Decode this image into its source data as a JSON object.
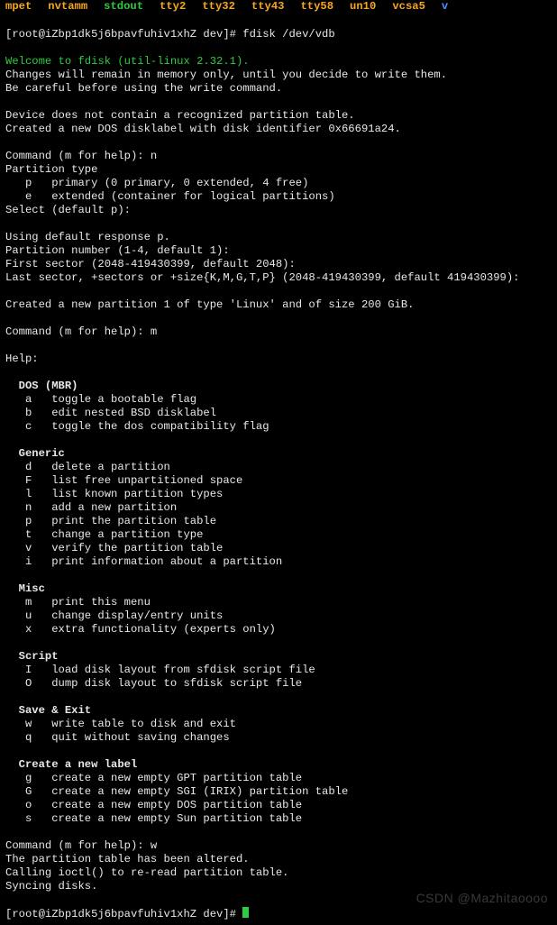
{
  "tabs": {
    "t0": "mpet",
    "t1": "nvtamm",
    "t2": "stdout",
    "t3": "tty2",
    "t4": "tty32",
    "t5": "tty43",
    "t6": "tty58",
    "t7": "un10",
    "t8": "vcsa5",
    "t9": "v"
  },
  "prompt": {
    "line": "[root@iZbp1dk5j6bpavfuhiv1xhZ dev]# fdisk /dev/vdb"
  },
  "welcome": "Welcome to fdisk (util-linux 2.32.1).",
  "intro": {
    "l1": "Changes will remain in memory only, until you decide to write them.",
    "l2": "Be careful before using the write command."
  },
  "device": {
    "l1": "Device does not contain a recognized partition table.",
    "l2": "Created a new DOS disklabel with disk identifier 0x66691a24."
  },
  "cmd_n": "Command (m for help): n",
  "ptype": {
    "hdr": "Partition type",
    "p": "   p   primary (0 primary, 0 extended, 4 free)",
    "e": "   e   extended (container for logical partitions)",
    "sel": "Select (default p):"
  },
  "defaults": {
    "l1": "Using default response p.",
    "l2": "Partition number (1-4, default 1):",
    "l3": "First sector (2048-419430399, default 2048):",
    "l4": "Last sector, +sectors or +size{K,M,G,T,P} (2048-419430399, default 419430399):"
  },
  "created": "Created a new partition 1 of type 'Linux' and of size 200 GiB.",
  "cmd_m": "Command (m for help): m",
  "help_hdr": "Help:",
  "sections": {
    "dos": {
      "title": "  DOS (MBR)",
      "a": "   a   toggle a bootable flag",
      "b": "   b   edit nested BSD disklabel",
      "c": "   c   toggle the dos compatibility flag"
    },
    "generic": {
      "title": "  Generic",
      "d": "   d   delete a partition",
      "F": "   F   list free unpartitioned space",
      "l": "   l   list known partition types",
      "n": "   n   add a new partition",
      "p": "   p   print the partition table",
      "t": "   t   change a partition type",
      "v": "   v   verify the partition table",
      "i": "   i   print information about a partition"
    },
    "misc": {
      "title": "  Misc",
      "m": "   m   print this menu",
      "u": "   u   change display/entry units",
      "x": "   x   extra functionality (experts only)"
    },
    "script": {
      "title": "  Script",
      "I": "   I   load disk layout from sfdisk script file",
      "O": "   O   dump disk layout to sfdisk script file"
    },
    "save": {
      "title": "  Save & Exit",
      "w": "   w   write table to disk and exit",
      "q": "   q   quit without saving changes"
    },
    "label": {
      "title": "  Create a new label",
      "g": "   g   create a new empty GPT partition table",
      "G": "   G   create a new empty SGI (IRIX) partition table",
      "o": "   o   create a new empty DOS partition table",
      "s": "   s   create a new empty Sun partition table"
    }
  },
  "cmd_w": "Command (m for help): w",
  "finish": {
    "l1": "The partition table has been altered.",
    "l2": "Calling ioctl() to re-read partition table.",
    "l3": "Syncing disks."
  },
  "final_prompt": "[root@iZbp1dk5j6bpavfuhiv1xhZ dev]# ",
  "watermark": "CSDN @Mazhitaoooo"
}
